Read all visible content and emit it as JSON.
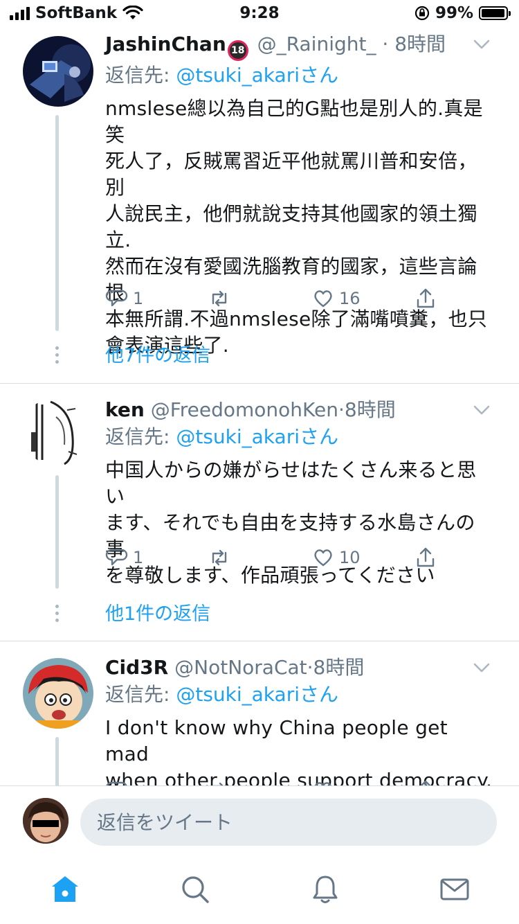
{
  "status": {
    "carrier": "SoftBank",
    "time": "9:28",
    "battery": "99%"
  },
  "tweets": [
    {
      "name": "JashinChan",
      "badge": "18",
      "handle": "@_Rainight_",
      "dot": "·",
      "time": "8時間",
      "reply_prefix": "返信先: ",
      "reply_to": "@tsuki_akari",
      "reply_suffix": "さん",
      "body_lines": [
        "nmslese總以為自己的G點也是別人的.真是笑",
        "死人了，反賊罵習近平他就罵川普和安倍，別",
        "人說民主，他們就說支持其他國家的領土獨",
        "立.",
        "然而在沒有愛國洗腦教育的國家，這些言論根",
        "本無所謂.不過nmslese除了滿嘴噴糞，也只",
        "會表演這些了."
      ],
      "replies": "1",
      "likes": "16",
      "more": "他7件の返信"
    },
    {
      "name": "ken",
      "handle": "@FreedomonohKen",
      "dot": "·",
      "time": "8時間",
      "reply_prefix": "返信先: ",
      "reply_to": "@tsuki_akari",
      "reply_suffix": "さん",
      "body_lines": [
        "中国人からの嫌がらせはたくさん来ると思い",
        "ます、それでも自由を支持する水島さんの事",
        "を尊敬します、作品頑張ってください"
      ],
      "replies": "1",
      "likes": "10",
      "more": "他1件の返信"
    },
    {
      "name": "Cid3R",
      "handle": "@NotNoraCat",
      "dot": "·",
      "time": "8時間",
      "reply_prefix": "返信先: ",
      "reply_to": "@tsuki_akari",
      "reply_suffix": "さん",
      "body_lines": [
        "I don't know why China people get mad",
        "when other people support democracy."
      ]
    }
  ],
  "reply_bar": {
    "placeholder": "返信をツイート"
  },
  "tabs": [
    "home-icon",
    "search-icon",
    "notifications-icon",
    "messages-icon"
  ],
  "colors": {
    "accent": "#1da1f2",
    "muted": "#657786",
    "text": "#14171a"
  }
}
